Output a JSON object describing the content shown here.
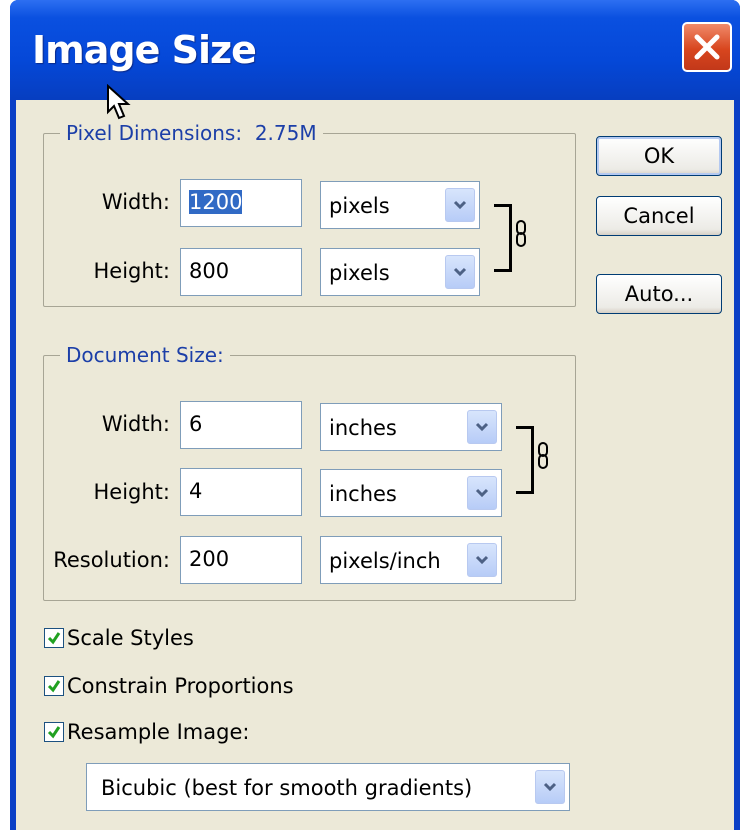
{
  "window": {
    "title": "Image Size"
  },
  "pixel_dimensions": {
    "legend": "Pixel Dimensions:",
    "size": "2.75M",
    "width_label": "Width:",
    "width_value": "1200",
    "width_unit": "pixels",
    "height_label": "Height:",
    "height_value": "800",
    "height_unit": "pixels"
  },
  "document_size": {
    "legend": "Document Size:",
    "width_label": "Width:",
    "width_value": "6",
    "width_unit": "inches",
    "height_label": "Height:",
    "height_value": "4",
    "height_unit": "inches",
    "resolution_label": "Resolution:",
    "resolution_value": "200",
    "resolution_unit": "pixels/inch"
  },
  "buttons": {
    "ok": "OK",
    "cancel": "Cancel",
    "auto": "Auto..."
  },
  "options": {
    "scale_styles": "Scale Styles",
    "constrain_proportions": "Constrain Proportions",
    "resample_image": "Resample Image:",
    "resample_method": "Bicubic (best for smooth gradients)",
    "scale_styles_checked": true,
    "constrain_checked": true,
    "resample_checked": true
  },
  "colors": {
    "titlebar": "#0548d8",
    "dialog_bg": "#ece9d8",
    "group_label": "#1c3fa8",
    "check": "#21a121",
    "close": "#d8461e"
  }
}
